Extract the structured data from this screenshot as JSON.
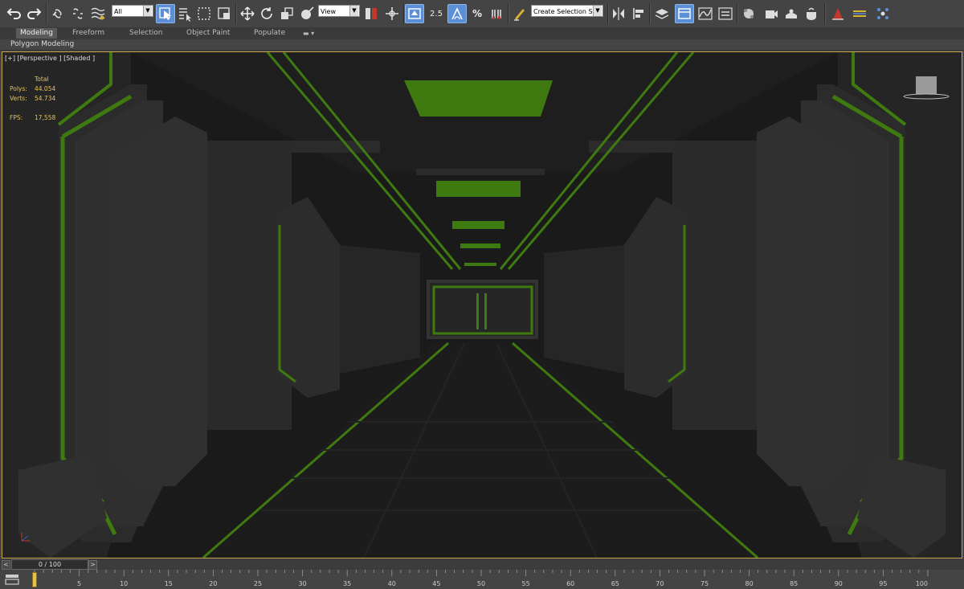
{
  "toolbar": {
    "selection_filter": "All",
    "reference_coord": "View",
    "named_selection_placeholder": "Create Selection Se",
    "snap_label": "2.5",
    "icons": [
      "undo-icon",
      "redo-icon",
      "link-icon",
      "unlink-icon",
      "bind-spacewarp-icon",
      "select-object-icon",
      "select-by-name-icon",
      "rect-region-icon",
      "window-crossing-icon",
      "select-move-icon",
      "select-rotate-icon",
      "select-scale-icon",
      "pivot-icon",
      "keyboard-shortcut-icon",
      "snap-icon",
      "angle-snap-icon",
      "percent-snap-icon",
      "spinner-snap-icon",
      "edit-named-selection-icon",
      "mirror-icon",
      "align-icon",
      "layer-explorer-icon",
      "scene-explorer-icon",
      "curve-editor-icon",
      "schematic-icon",
      "material-editor-icon",
      "render-setup-icon",
      "rendered-frame-icon",
      "render-icon",
      "render-cloud-icon",
      "arnold-icon",
      "toggle-ribbon-icon",
      "viewport-layout-icon"
    ]
  },
  "ribbon": {
    "tabs": [
      "Modeling",
      "Freeform",
      "Selection",
      "Object Paint",
      "Populate"
    ],
    "active_tab": "Modeling",
    "panel_label": "Polygon Modeling"
  },
  "viewport": {
    "label": "[+] [Perspective ] [Shaded ]",
    "stats": {
      "header": "Total",
      "polys_label": "Polys:",
      "polys": "44.054",
      "verts_label": "Verts:",
      "verts": "54.734",
      "fps_label": "FPS:",
      "fps": "17,558"
    }
  },
  "timeline": {
    "frame_display": "0 / 100",
    "prev_label": "<",
    "next_label": ">",
    "current_frame": 0,
    "ticks": [
      "5",
      "10",
      "15",
      "20",
      "25",
      "30",
      "35",
      "40",
      "45",
      "50",
      "55",
      "60",
      "65",
      "70",
      "75",
      "80",
      "85",
      "90",
      "95",
      "100"
    ]
  },
  "colors": {
    "accent_green": "#3f7a10",
    "viewport_border": "#c8a24a",
    "stats_text": "#e3c25a",
    "active_button": "#5b8fd6"
  }
}
